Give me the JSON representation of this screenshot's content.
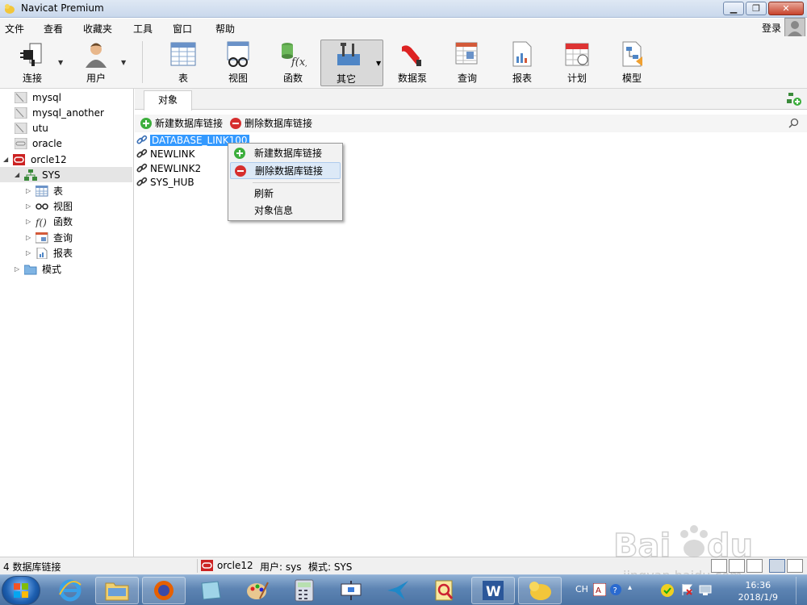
{
  "window": {
    "title": "Navicat Premium"
  },
  "menu": {
    "items": [
      "文件",
      "查看",
      "收藏夹",
      "工具",
      "窗口",
      "帮助"
    ],
    "login": "登录"
  },
  "toolbar": {
    "buttons": [
      "连接",
      "用户",
      "表",
      "视图",
      "函数",
      "其它",
      "数据泵",
      "查询",
      "报表",
      "计划",
      "模型"
    ],
    "active": "其它"
  },
  "sidebar": {
    "connections": [
      "mysql",
      "mysql_another",
      "utu",
      "oracle",
      "orcle12"
    ],
    "schema": "SYS",
    "children": [
      "表",
      "视图",
      "函数",
      "查询",
      "报表"
    ],
    "mode": "模式"
  },
  "tabs": {
    "objects": "对象"
  },
  "object_toolbar": {
    "new_link": "新建数据库链接",
    "delete_link": "删除数据库链接"
  },
  "objects": [
    "DATABASE_LINK100",
    "NEWLINK",
    "NEWLINK2",
    "SYS_HUB"
  ],
  "context_menu": {
    "items": [
      "新建数据库链接",
      "删除数据库链接",
      "刷新",
      "对象信息"
    ],
    "highlighted": "删除数据库链接"
  },
  "status": {
    "count": "4 数据库链接",
    "connection": "orcle12",
    "user": "用户: sys",
    "schema": "模式: SYS"
  },
  "taskbar": {
    "lang": "CH",
    "time": "16:36",
    "date": "2018/1/9"
  },
  "watermark": {
    "url": "jingyan.baidu.com"
  },
  "colors": {
    "selection": "#3399ff",
    "oracle_red": "#cc2222",
    "menu_hover": "#dce9f7"
  }
}
